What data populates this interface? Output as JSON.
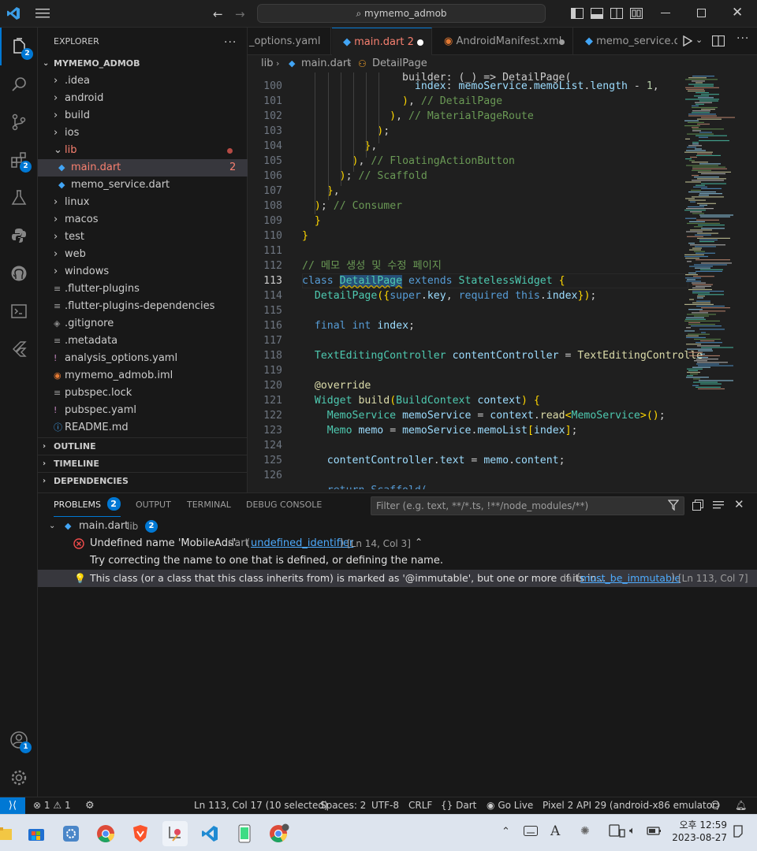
{
  "titlebar": {
    "search_text": "mymemo_admob"
  },
  "activity": {
    "explorer_badge": "2",
    "extensions_badge": "2",
    "accounts_badge": "1"
  },
  "explorer": {
    "header": "EXPLORER",
    "more": "...",
    "project": "MYMEMO_ADMOB",
    "items": [
      {
        "label": ".idea",
        "kind": "folder"
      },
      {
        "label": "android",
        "kind": "folder"
      },
      {
        "label": "build",
        "kind": "folder"
      },
      {
        "label": "ios",
        "kind": "folder"
      },
      {
        "label": "lib",
        "kind": "folder-open"
      },
      {
        "label": "main.dart",
        "kind": "dart",
        "badge": "2"
      },
      {
        "label": "memo_service.dart",
        "kind": "dart"
      },
      {
        "label": "linux",
        "kind": "folder"
      },
      {
        "label": "macos",
        "kind": "folder"
      },
      {
        "label": "test",
        "kind": "folder"
      },
      {
        "label": "web",
        "kind": "folder"
      },
      {
        "label": "windows",
        "kind": "folder"
      },
      {
        "label": ".flutter-plugins",
        "kind": "text"
      },
      {
        "label": ".flutter-plugins-dependencies",
        "kind": "text"
      },
      {
        "label": ".gitignore",
        "kind": "git"
      },
      {
        "label": ".metadata",
        "kind": "text"
      },
      {
        "label": "analysis_options.yaml",
        "kind": "yaml"
      },
      {
        "label": "mymemo_admob.iml",
        "kind": "xml"
      },
      {
        "label": "pubspec.lock",
        "kind": "text"
      },
      {
        "label": "pubspec.yaml",
        "kind": "yaml"
      },
      {
        "label": "README.md",
        "kind": "info"
      }
    ],
    "sections": [
      "OUTLINE",
      "TIMELINE",
      "DEPENDENCIES"
    ]
  },
  "tabs": [
    {
      "label": "_options.yaml"
    },
    {
      "label": "main.dart",
      "badge": "2"
    },
    {
      "label": "AndroidManifest.xml"
    },
    {
      "label": "memo_service.da"
    }
  ],
  "breadcrumb": [
    "lib",
    "main.dart",
    "DetailPage"
  ],
  "editor": {
    "lines": [
      {
        "n": "100",
        "t": "                  index: memoService.memoList.length - 1,"
      },
      {
        "n": "101",
        "t": "                ), // DetailPage"
      },
      {
        "n": "102",
        "t": "              ), // MaterialPageRoute"
      },
      {
        "n": "103",
        "t": "            );"
      },
      {
        "n": "104",
        "t": "          },"
      },
      {
        "n": "105",
        "t": "        ), // FloatingActionButton"
      },
      {
        "n": "106",
        "t": "      ); // Scaffold"
      },
      {
        "n": "107",
        "t": "    },"
      },
      {
        "n": "108",
        "t": "  ); // Consumer"
      },
      {
        "n": "109",
        "t": "  }"
      },
      {
        "n": "110",
        "t": "}"
      },
      {
        "n": "111",
        "t": ""
      },
      {
        "n": "112",
        "t": "// 메모 생성 및 수정 페이지"
      },
      {
        "n": "113",
        "t": "class DetailPage extends StatelessWidget {"
      },
      {
        "n": "114",
        "t": "  DetailPage({super.key, required this.index});"
      },
      {
        "n": "115",
        "t": ""
      },
      {
        "n": "116",
        "t": "  final int index;"
      },
      {
        "n": "117",
        "t": ""
      },
      {
        "n": "118",
        "t": "  TextEditingController contentController = TextEditingControlle"
      },
      {
        "n": "119",
        "t": ""
      },
      {
        "n": "120",
        "t": "  @override"
      },
      {
        "n": "121",
        "t": "  Widget build(BuildContext context) {"
      },
      {
        "n": "122",
        "t": "    MemoService memoService = context.read<MemoService>();"
      },
      {
        "n": "123",
        "t": "    Memo memo = memoService.memoList[index];"
      },
      {
        "n": "124",
        "t": ""
      },
      {
        "n": "125",
        "t": "    contentController.text = memo.content;"
      },
      {
        "n": "126",
        "t": ""
      }
    ],
    "partial_top": "                builder: (_) => DetailPage(",
    "partial_bottom": "    return Scaffold("
  },
  "panel": {
    "tabs": [
      "PROBLEMS",
      "OUTPUT",
      "TERMINAL",
      "DEBUG CONSOLE"
    ],
    "problems_count": "2",
    "filter_placeholder": "Filter (e.g. text, **/*.ts, !**/node_modules/**)",
    "file": {
      "name": "main.dart",
      "dir": "lib",
      "count": "2"
    },
    "problems": [
      {
        "message": "Undefined name 'MobileAds'.",
        "source": "dart",
        "code": "undefined_identifier",
        "loc": "[Ln 14, Col 3]",
        "hint": "Try correcting the name to one that is defined, or defining the name."
      },
      {
        "message": "This class (or a class that this class inherits from) is marked as '@immutable', but one or more of its in...",
        "source": "dart",
        "code": "must_be_immutable",
        "loc": "[Ln 113, Col 7]"
      }
    ]
  },
  "status": {
    "errors": "1",
    "warnings": "1",
    "position": "Ln 113, Col 17 (10 selected)",
    "spaces": "Spaces: 2",
    "encoding": "UTF-8",
    "eol": "CRLF",
    "language": "Dart",
    "golive": "Go Live",
    "device": "Pixel 2 API 29 (android-x86 emulator)"
  },
  "taskbar": {
    "ampm_time": "오후 12:59",
    "date": "2023-08-27"
  },
  "colors": {
    "accent": "#0078d4",
    "error": "#f14c4c",
    "keyword": "#569cd6",
    "type": "#4ec9b0",
    "func": "#dcdcaa",
    "var": "#9cdcfe",
    "comment": "#6a9955"
  }
}
